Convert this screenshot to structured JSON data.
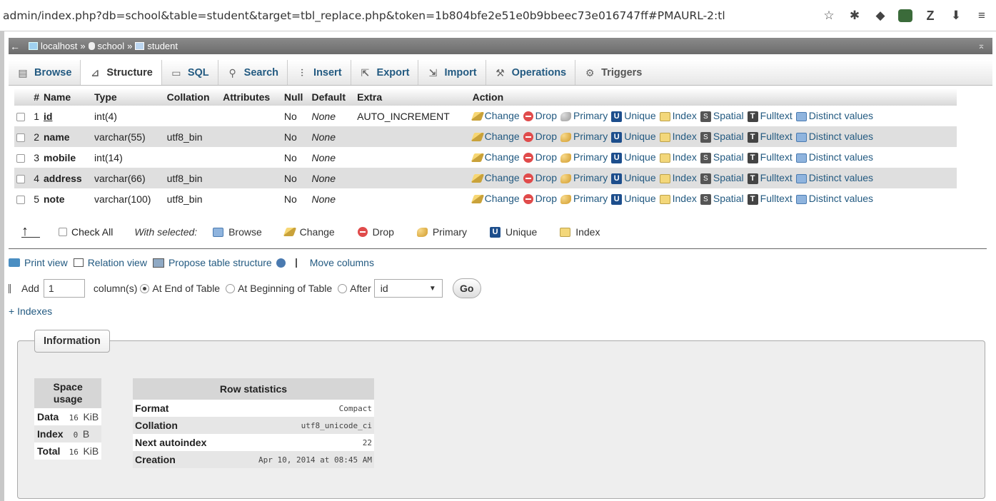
{
  "browser": {
    "url": "admin/index.php?db=school&table=student&target=tbl_replace.php&token=1b804bfe2e51e0b9bbeec73e016747ff#PMAURL-2:tl"
  },
  "breadcrumb": {
    "server": "localhost",
    "sep1": "»",
    "database": "school",
    "sep2": "»",
    "table": "student"
  },
  "tabs": [
    {
      "label": "Browse",
      "icon": "browse-icon"
    },
    {
      "label": "Structure",
      "icon": "structure-icon"
    },
    {
      "label": "SQL",
      "icon": "sql-icon"
    },
    {
      "label": "Search",
      "icon": "search-icon"
    },
    {
      "label": "Insert",
      "icon": "insert-icon"
    },
    {
      "label": "Export",
      "icon": "export-icon"
    },
    {
      "label": "Import",
      "icon": "import-icon"
    },
    {
      "label": "Operations",
      "icon": "wrench-icon"
    },
    {
      "label": "Triggers",
      "icon": "triggers-icon"
    }
  ],
  "structure": {
    "headers": {
      "num": "#",
      "name": "Name",
      "type": "Type",
      "collation": "Collation",
      "attributes": "Attributes",
      "null": "Null",
      "default": "Default",
      "extra": "Extra",
      "action": "Action"
    },
    "actions": {
      "change": "Change",
      "drop": "Drop",
      "primary": "Primary",
      "unique": "Unique",
      "index": "Index",
      "spatial": "Spatial",
      "fulltext": "Fulltext",
      "distinct": "Distinct values"
    },
    "rows": [
      {
        "num": "1",
        "name": "id",
        "type": "int(4)",
        "collation": "",
        "attributes": "",
        "null": "No",
        "default": "None",
        "extra": "AUTO_INCREMENT"
      },
      {
        "num": "2",
        "name": "name",
        "type": "varchar(55)",
        "collation": "utf8_bin",
        "attributes": "",
        "null": "No",
        "default": "None",
        "extra": ""
      },
      {
        "num": "3",
        "name": "mobile",
        "type": "int(14)",
        "collation": "",
        "attributes": "",
        "null": "No",
        "default": "None",
        "extra": ""
      },
      {
        "num": "4",
        "name": "address",
        "type": "varchar(66)",
        "collation": "utf8_bin",
        "attributes": "",
        "null": "No",
        "default": "None",
        "extra": ""
      },
      {
        "num": "5",
        "name": "note",
        "type": "varchar(100)",
        "collation": "utf8_bin",
        "attributes": "",
        "null": "No",
        "default": "None",
        "extra": ""
      }
    ]
  },
  "bulk": {
    "check_all": "Check All",
    "with_selected": "With selected:",
    "browse": "Browse",
    "change": "Change",
    "drop": "Drop",
    "primary": "Primary",
    "unique": "Unique",
    "index": "Index"
  },
  "links": {
    "print_view": "Print view",
    "relation_view": "Relation view",
    "propose": "Propose table structure",
    "move_columns": "Move columns"
  },
  "add_columns": {
    "add": "Add",
    "count": "1",
    "columns_label": "column(s)",
    "at_end": "At End of Table",
    "at_beginning": "At Beginning of Table",
    "after": "After",
    "after_field": "id",
    "go": "Go"
  },
  "indexes_link": "+ Indexes",
  "information": {
    "legend": "Information",
    "space_usage": {
      "title_line1": "Space",
      "title_line2": "usage",
      "rows": [
        {
          "label": "Data",
          "value": "16",
          "unit": "KiB"
        },
        {
          "label": "Index",
          "value": "0",
          "unit": "B"
        },
        {
          "label": "Total",
          "value": "16",
          "unit": "KiB"
        }
      ]
    },
    "row_statistics": {
      "title": "Row statistics",
      "rows": [
        {
          "label": "Format",
          "value": "Compact"
        },
        {
          "label": "Collation",
          "value": "utf8_unicode_ci"
        },
        {
          "label": "Next autoindex",
          "value": "22"
        },
        {
          "label": "Creation",
          "value": "Apr 10, 2014 at 08:45 AM"
        }
      ]
    }
  }
}
